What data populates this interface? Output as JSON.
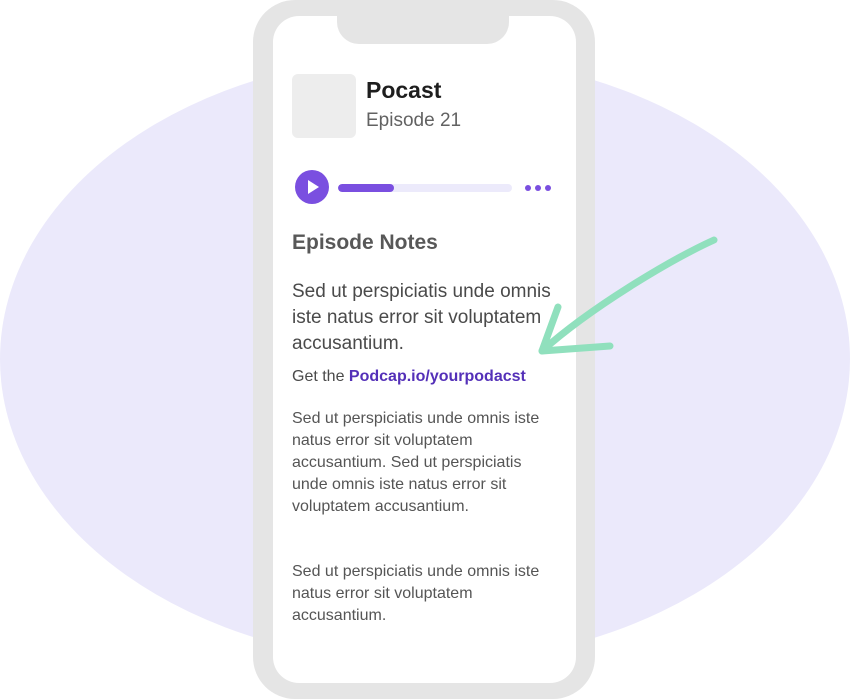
{
  "podcast": {
    "title": "Pocast",
    "episode": "Episode 21"
  },
  "player": {
    "progress_fraction": 0.32,
    "play_icon": "play-icon",
    "more_icon": "more-dots-icon"
  },
  "notes": {
    "heading": "Episode Notes",
    "lead": "Sed ut perspiciatis unde omnis iste natus error sit voluptatem accusantium.",
    "link_prefix": "Get the ",
    "link_text": "Podcap.io/yourpodacst",
    "paragraph_1": "Sed ut perspiciatis unde omnis iste natus error sit voluptatem accusantium. Sed ut perspiciatis unde omnis iste natus error sit voluptatem accusantium.",
    "paragraph_2": "Sed ut perspiciatis unde omnis iste natus error sit voluptatem accusantium."
  },
  "colors": {
    "accent": "#7a4fe0",
    "link": "#5430b8",
    "arrow": "#90e0bd",
    "background_ellipse": "#ebe9fb"
  }
}
